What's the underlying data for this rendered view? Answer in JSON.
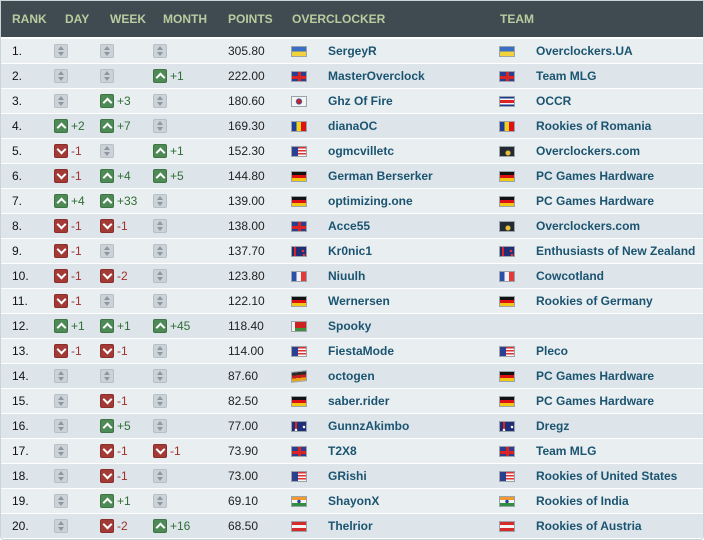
{
  "columns": {
    "rank": "RANK",
    "day": "DAY",
    "week": "WEEK",
    "month": "MONTH",
    "points": "POINTS",
    "overclocker": "OVERCLOCKER",
    "team": "TEAM"
  },
  "rows": [
    {
      "rank": "1.",
      "day": {
        "dir": "same",
        "text": ""
      },
      "week": {
        "dir": "same",
        "text": ""
      },
      "month": {
        "dir": "same",
        "text": ""
      },
      "points": "305.80",
      "name": "SergeyR",
      "flag": "ua",
      "team": "Overclockers.UA",
      "team_flag": "ua"
    },
    {
      "rank": "2.",
      "day": {
        "dir": "same",
        "text": ""
      },
      "week": {
        "dir": "same",
        "text": ""
      },
      "month": {
        "dir": "up",
        "text": "+1"
      },
      "points": "222.00",
      "name": "MasterOverclock",
      "flag": "gb",
      "team": "Team MLG",
      "team_flag": "gb"
    },
    {
      "rank": "3.",
      "day": {
        "dir": "same",
        "text": ""
      },
      "week": {
        "dir": "up",
        "text": "+3"
      },
      "month": {
        "dir": "same",
        "text": ""
      },
      "points": "180.60",
      "name": "Ghz Of Fire",
      "flag": "kr",
      "team": "OCCR",
      "team_flag": "cr"
    },
    {
      "rank": "4.",
      "day": {
        "dir": "up",
        "text": "+2"
      },
      "week": {
        "dir": "up",
        "text": "+7"
      },
      "month": {
        "dir": "same",
        "text": ""
      },
      "points": "169.30",
      "name": "dianaOC",
      "flag": "ro",
      "team": "Rookies of Romania",
      "team_flag": "ro"
    },
    {
      "rank": "5.",
      "day": {
        "dir": "down",
        "text": "-1"
      },
      "week": {
        "dir": "same",
        "text": ""
      },
      "month": {
        "dir": "up",
        "text": "+1"
      },
      "points": "152.30",
      "name": "ogmcvilletc",
      "flag": "us",
      "team": "Overclockers.com",
      "team_flag": "oc"
    },
    {
      "rank": "6.",
      "day": {
        "dir": "down",
        "text": "-1"
      },
      "week": {
        "dir": "up",
        "text": "+4"
      },
      "month": {
        "dir": "up",
        "text": "+5"
      },
      "points": "144.80",
      "name": "German Berserker",
      "flag": "de",
      "team": "PC Games Hardware",
      "team_flag": "de"
    },
    {
      "rank": "7.",
      "day": {
        "dir": "up",
        "text": "+4"
      },
      "week": {
        "dir": "up",
        "text": "+33"
      },
      "month": {
        "dir": "same",
        "text": ""
      },
      "points": "139.00",
      "name": "optimizing.one",
      "flag": "de",
      "team": "PC Games Hardware",
      "team_flag": "de"
    },
    {
      "rank": "8.",
      "day": {
        "dir": "down",
        "text": "-1"
      },
      "week": {
        "dir": "down",
        "text": "-1"
      },
      "month": {
        "dir": "same",
        "text": ""
      },
      "points": "138.00",
      "name": "Acce55",
      "flag": "gb",
      "team": "Overclockers.com",
      "team_flag": "oc"
    },
    {
      "rank": "9.",
      "day": {
        "dir": "down",
        "text": "-1"
      },
      "week": {
        "dir": "same",
        "text": ""
      },
      "month": {
        "dir": "same",
        "text": ""
      },
      "points": "137.70",
      "name": "Kr0nic1",
      "flag": "nz",
      "team": "Enthusiasts of New Zealand",
      "team_flag": "nz"
    },
    {
      "rank": "10.",
      "day": {
        "dir": "down",
        "text": "-1"
      },
      "week": {
        "dir": "down",
        "text": "-2"
      },
      "month": {
        "dir": "same",
        "text": ""
      },
      "points": "123.80",
      "name": "Niuulh",
      "flag": "fr",
      "team": "Cowcotland",
      "team_flag": "fr"
    },
    {
      "rank": "11.",
      "day": {
        "dir": "down",
        "text": "-1"
      },
      "week": {
        "dir": "same",
        "text": ""
      },
      "month": {
        "dir": "same",
        "text": ""
      },
      "points": "122.10",
      "name": "Wernersen",
      "flag": "de",
      "team": "Rookies of Germany",
      "team_flag": "de"
    },
    {
      "rank": "12.",
      "day": {
        "dir": "up",
        "text": "+1"
      },
      "week": {
        "dir": "up",
        "text": "+1"
      },
      "month": {
        "dir": "up",
        "text": "+45"
      },
      "points": "118.40",
      "name": "Spooky",
      "flag": "by",
      "team": "",
      "team_flag": ""
    },
    {
      "rank": "13.",
      "day": {
        "dir": "down",
        "text": "-1"
      },
      "week": {
        "dir": "down",
        "text": "-1"
      },
      "month": {
        "dir": "same",
        "text": ""
      },
      "points": "114.00",
      "name": "FiestaMode",
      "flag": "us",
      "team": "Pleco",
      "team_flag": "us"
    },
    {
      "rank": "14.",
      "day": {
        "dir": "same",
        "text": ""
      },
      "week": {
        "dir": "same",
        "text": ""
      },
      "month": {
        "dir": "same",
        "text": ""
      },
      "points": "87.60",
      "name": "octogen",
      "flag": "dd",
      "team": "PC Games Hardware",
      "team_flag": "de"
    },
    {
      "rank": "15.",
      "day": {
        "dir": "same",
        "text": ""
      },
      "week": {
        "dir": "down",
        "text": "-1"
      },
      "month": {
        "dir": "same",
        "text": ""
      },
      "points": "82.50",
      "name": "saber.rider",
      "flag": "de",
      "team": "PC Games Hardware",
      "team_flag": "de"
    },
    {
      "rank": "16.",
      "day": {
        "dir": "same",
        "text": ""
      },
      "week": {
        "dir": "up",
        "text": "+5"
      },
      "month": {
        "dir": "same",
        "text": ""
      },
      "points": "77.00",
      "name": "GunnzAkimbo",
      "flag": "au",
      "team": "Dregz",
      "team_flag": "au"
    },
    {
      "rank": "17.",
      "day": {
        "dir": "same",
        "text": ""
      },
      "week": {
        "dir": "down",
        "text": "-1"
      },
      "month": {
        "dir": "down",
        "text": "-1"
      },
      "points": "73.90",
      "name": "T2X8",
      "flag": "gb",
      "team": "Team MLG",
      "team_flag": "gb"
    },
    {
      "rank": "18.",
      "day": {
        "dir": "same",
        "text": ""
      },
      "week": {
        "dir": "down",
        "text": "-1"
      },
      "month": {
        "dir": "same",
        "text": ""
      },
      "points": "73.00",
      "name": "GRishi",
      "flag": "us",
      "team": "Rookies of United States",
      "team_flag": "us"
    },
    {
      "rank": "19.",
      "day": {
        "dir": "same",
        "text": ""
      },
      "week": {
        "dir": "up",
        "text": "+1"
      },
      "month": {
        "dir": "same",
        "text": ""
      },
      "points": "69.10",
      "name": "ShayonX",
      "flag": "in",
      "team": "Rookies of India",
      "team_flag": "in"
    },
    {
      "rank": "20.",
      "day": {
        "dir": "same",
        "text": ""
      },
      "week": {
        "dir": "down",
        "text": "-2"
      },
      "month": {
        "dir": "up",
        "text": "+16"
      },
      "points": "68.50",
      "name": "Thelrior",
      "flag": "at",
      "team": "Rookies of Austria",
      "team_flag": "at"
    }
  ],
  "flag_icons": {
    "ua": "flag-ukraine-icon",
    "gb": "flag-uk-icon",
    "kr": "flag-south-korea-icon",
    "cr": "flag-costa-rica-icon",
    "ro": "flag-romania-icon",
    "us": "flag-usa-icon",
    "de": "flag-germany-icon",
    "oc": "overclockers-com-logo-icon",
    "nz": "flag-new-zealand-icon",
    "fr": "flag-france-icon",
    "by": "flag-belarus-icon",
    "au": "flag-australia-icon",
    "in": "flag-india-icon",
    "at": "flag-austria-icon",
    "dd": "flag-east-germany-icon"
  },
  "colors": {
    "header_bg": "#3f4b51",
    "header_text": "#b9cc9f",
    "link": "#1b5470",
    "up": "#4e8a55",
    "down": "#a33a36",
    "same": "#ccd3d8"
  }
}
